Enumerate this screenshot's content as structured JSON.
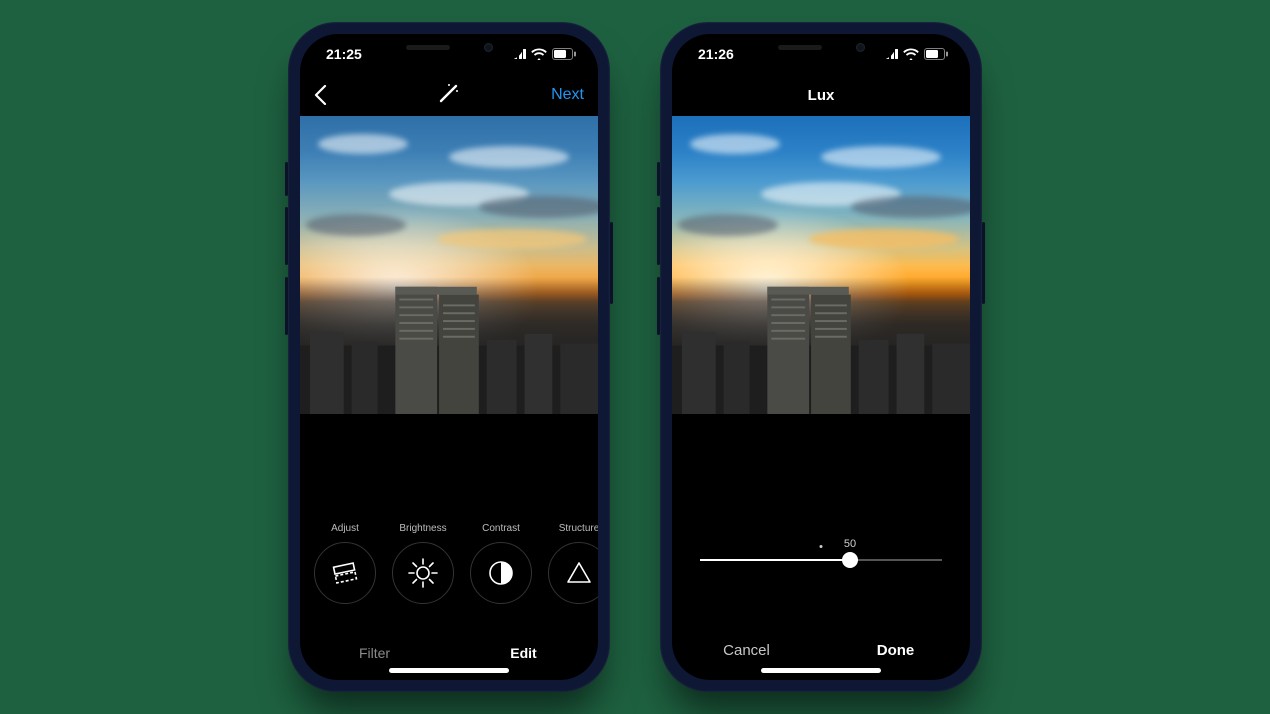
{
  "phone1": {
    "status": {
      "time": "21:25"
    },
    "nav": {
      "next": "Next"
    },
    "tools": [
      {
        "key": "adjust",
        "label": "Adjust"
      },
      {
        "key": "brightness",
        "label": "Brightness"
      },
      {
        "key": "contrast",
        "label": "Contrast"
      },
      {
        "key": "structure",
        "label": "Structure"
      }
    ],
    "tabs": {
      "filter": "Filter",
      "edit": "Edit"
    }
  },
  "phone2": {
    "status": {
      "time": "21:26"
    },
    "nav": {
      "title": "Lux"
    },
    "slider": {
      "value": 50,
      "percent": 62
    },
    "actions": {
      "cancel": "Cancel",
      "done": "Done"
    }
  }
}
